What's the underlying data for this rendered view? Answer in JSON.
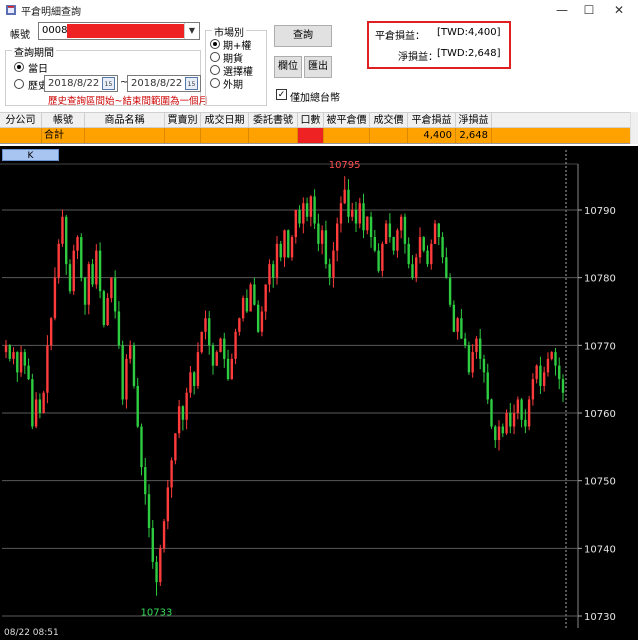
{
  "window": {
    "title": "平倉明細查詢",
    "minimize": "—",
    "maximize": "☐",
    "close": "✕"
  },
  "form": {
    "account_label": "帳號",
    "account_value": "0008",
    "query_period_label": "查詢期間",
    "today_label": "當日",
    "history_label": "歷史",
    "date_from": "2018/8/22",
    "date_to": "2018/8/22",
    "date_sep": "~",
    "cal_icon_text": "15",
    "hint": "歷史查詢區間始~結束間範圍為一個月",
    "market_label": "市場別",
    "market_options": [
      "期+權",
      "期貨",
      "選擇權",
      "外期"
    ],
    "market_selected": "期+權",
    "query_button": "查詢",
    "columns_button": "欄位",
    "export_button": "匯出",
    "twd_only_label": "僅加總台幣",
    "twd_only_checked": true
  },
  "pl_summary": {
    "close_pl_label": "平倉損益：",
    "close_pl_value": "[TWD:4,400]",
    "net_pl_label": "淨損益：",
    "net_pl_value": "[TWD:2,648]"
  },
  "grid": {
    "headers": [
      "分公司",
      "帳號",
      "商品名稱",
      "買賣別",
      "成交日期",
      "委託書號",
      "口數",
      "被平倉價",
      "成交價",
      "平倉損益",
      "淨損益"
    ],
    "total_row": {
      "account": "合計",
      "close_pl": "4,400",
      "net_pl": "2,648"
    }
  },
  "chart": {
    "tab_label": "K",
    "footer_time": "08/22 08:51",
    "high_label": "10795",
    "low_label": "10733",
    "y_ticks": [
      "10790",
      "10780",
      "10770",
      "10760",
      "10750",
      "10740",
      "10730"
    ],
    "colors": {
      "up": "#ff3b3b",
      "down": "#2ecc40",
      "background": "#000000",
      "grid": "#5a5a5a",
      "high_label": "#ff5050",
      "low_label": "#33dd55",
      "pl_box": "#e02020",
      "summary_row": "#ffa200"
    }
  },
  "chart_data": {
    "type": "candlestick",
    "ylim": [
      10727,
      10800
    ],
    "y_ticks": [
      10790,
      10780,
      10770,
      10760,
      10750,
      10740,
      10730
    ],
    "high": 10795,
    "low": 10733,
    "closes": [
      10770,
      10768,
      10769,
      10766,
      10769,
      10767,
      10765,
      10758,
      10762,
      10760,
      10763,
      10770,
      10774,
      10780,
      10785,
      10789,
      10782,
      10778,
      10784,
      10786,
      10780,
      10776,
      10782,
      10779,
      10784,
      10778,
      10773,
      10777,
      10780,
      10775,
      10770,
      10762,
      10768,
      10770,
      10764,
      10758,
      10752,
      10748,
      10743,
      10738,
      10735,
      10740,
      10744,
      10749,
      10753,
      10757,
      10761,
      10759,
      10763,
      10766,
      10764,
      10769,
      10772,
      10774,
      10770,
      10767,
      10769,
      10771,
      10768,
      10765,
      10768,
      10772,
      10774,
      10777,
      10775,
      10779,
      10776,
      10772,
      10775,
      10779,
      10782,
      10780,
      10785,
      10783,
      10787,
      10783,
      10786,
      10790,
      10788,
      10791,
      10789,
      10792,
      10788,
      10785,
      10787,
      10782,
      10780,
      10784,
      10788,
      10791,
      10793,
      10789,
      10790,
      10788,
      10791,
      10787,
      10789,
      10786,
      10784,
      10781,
      10785,
      10788,
      10786,
      10784,
      10787,
      10789,
      10785,
      10782,
      10780,
      10783,
      10786,
      10784,
      10782,
      10785,
      10788,
      10786,
      10783,
      10780,
      10776,
      10772,
      10774,
      10771,
      10770,
      10766,
      10769,
      10771,
      10768,
      10766,
      10762,
      10758,
      10756,
      10758,
      10757,
      10760,
      10758,
      10760,
      10762,
      10759,
      10758,
      10762,
      10765,
      10767,
      10764,
      10766,
      10768,
      10769,
      10767,
      10765,
      10763
    ]
  }
}
